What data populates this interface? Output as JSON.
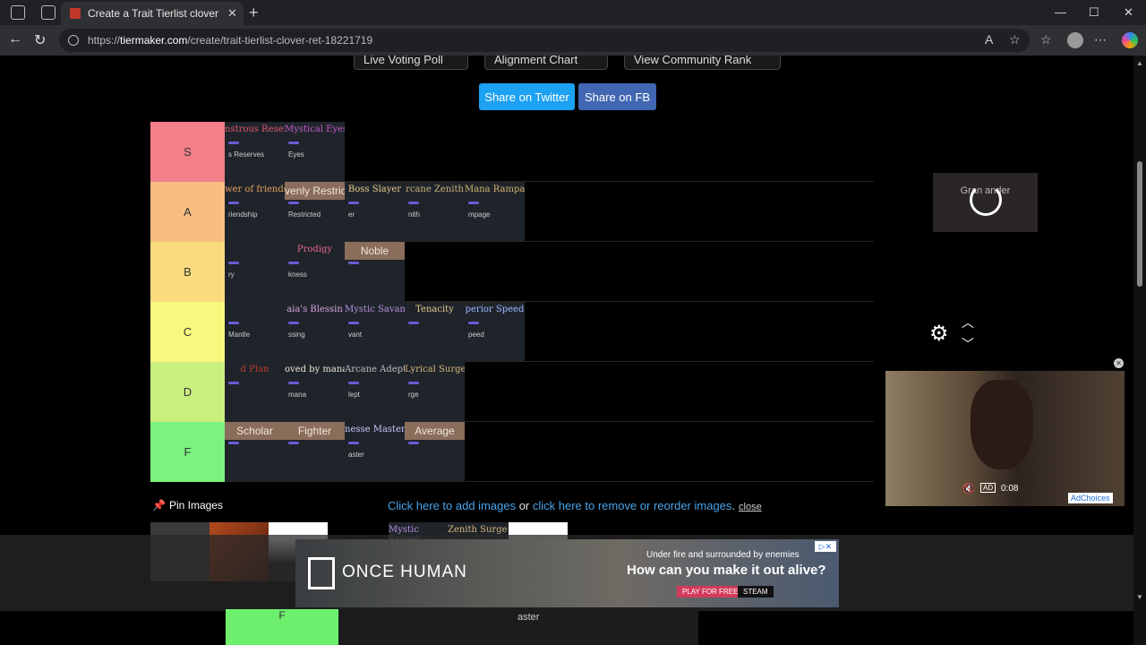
{
  "browser": {
    "tab_title": "Create a Trait Tierlist clover ret Tie",
    "url_prefix": "https://",
    "url_host": "tiermaker.com",
    "url_path": "/create/trait-tierlist-clover-ret-18221719",
    "new_tab": "+",
    "close_tab": "✕",
    "minimize": "—",
    "maximize": "☐",
    "close_window": "✕"
  },
  "top_buttons": [
    "Live Voting Poll",
    "Alignment Chart",
    "View Community Rank"
  ],
  "share": {
    "twitter": "Share on Twitter",
    "fb": "Share on FB",
    "twitter_color": "#1da1f2",
    "fb_color": "#4267b2"
  },
  "tiers": [
    {
      "label": "S",
      "color": "#f27f8a",
      "items": [
        {
          "title": "nstrous Reserv",
          "sub": "s Reserves",
          "color": "#e0576b"
        },
        {
          "title": "Mystical Eyes",
          "sub": "Eyes",
          "color": "#c45cc8"
        }
      ]
    },
    {
      "label": "A",
      "color": "#f7be80",
      "items": [
        {
          "title": "wer of friends",
          "sub": "riendship",
          "color": "#e6a15a"
        },
        {
          "title": "venly Restric",
          "sub": "Restricted",
          "color": "#f0e6d6",
          "tan": true
        },
        {
          "title": "Boss Slayer",
          "sub": "er",
          "color": "#e9c98a"
        },
        {
          "title": "rcane Zenith",
          "sub": "nith",
          "color": "#c8b27a"
        },
        {
          "title": "Mana Rampage",
          "sub": "mpage",
          "color": "#d4b06a"
        }
      ]
    },
    {
      "label": "B",
      "color": "#fadb7e",
      "items": [
        {
          "title": "",
          "sub": "ry",
          "color": "#ccc"
        },
        {
          "title": "Prodigy",
          "sub": "kness",
          "color": "#e46a8c"
        },
        {
          "title": "Noble",
          "sub": "",
          "color": "#f0e6d6",
          "tan": true
        }
      ]
    },
    {
      "label": "C",
      "color": "#f9f77e",
      "items": [
        {
          "title": "",
          "sub": "Mantle",
          "color": "#ccc"
        },
        {
          "title": "aia's Blessin",
          "sub": "ssing",
          "color": "#d9a2e0"
        },
        {
          "title": "Mystic Savant",
          "sub": "vant",
          "color": "#b88fe0"
        },
        {
          "title": "Tenacity",
          "sub": "",
          "color": "#e6c98a"
        },
        {
          "title": "perior Speed",
          "sub": "peed",
          "color": "#9db8ff"
        }
      ]
    },
    {
      "label": "D",
      "color": "#c9ef7f",
      "items": [
        {
          "title": "d Plan",
          "sub": "",
          "color": "#c0392b"
        },
        {
          "title": "oved by mana",
          "sub": "mana",
          "color": "#f0e6d6"
        },
        {
          "title": "Arcane Adept",
          "sub": "lept",
          "color": "#bfbfbf"
        },
        {
          "title": "Lyrical Surge",
          "sub": "rge",
          "color": "#d7b878"
        }
      ]
    },
    {
      "label": "F",
      "color": "#7cf37e",
      "items": [
        {
          "title": "Scholar",
          "sub": "",
          "color": "#f0e6d6",
          "tan": true
        },
        {
          "title": "Fighter",
          "sub": "",
          "color": "#f0e6d6",
          "tan": true
        },
        {
          "title": "nesse Master",
          "sub": "aster",
          "color": "#c8c8ff"
        },
        {
          "title": "Average",
          "sub": "",
          "color": "#f0e6d6",
          "tan": true
        }
      ]
    }
  ],
  "video": {
    "poster_text": "Gran   ander"
  },
  "ad_video": {
    "time": "0:08",
    "ad_badge": "AD",
    "choices": "AdChoices",
    "close": "✕"
  },
  "pin": {
    "label": "Pin Images"
  },
  "add_line": {
    "link1": "Click here to add images",
    "or": " or ",
    "link2": "click here to remove or reorder images",
    "period": ".",
    "close": "close"
  },
  "strip_labels": [
    "Mystic Savant",
    "Zenith Surge"
  ],
  "banner": {
    "brand": "ONCE HUMAN",
    "small": "Under fire and surrounded by enemies",
    "big": "How can you make it out alive?",
    "play": "PLAY FOR FREE",
    "steam": "STEAM"
  },
  "bottom": {
    "f_label": "F",
    "aster": "aster"
  }
}
